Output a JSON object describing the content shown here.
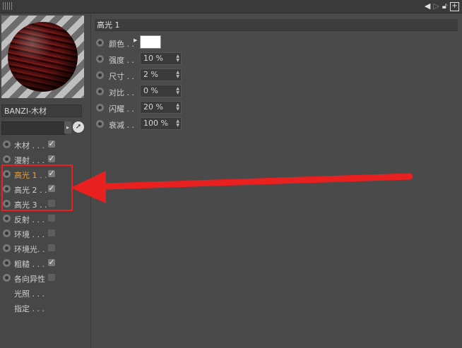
{
  "material_name": "BANZI-木材",
  "channels": [
    {
      "label": "木材 . . .",
      "checked": true
    },
    {
      "label": "漫射 . . .",
      "checked": true
    },
    {
      "label": "高光 1 . .",
      "checked": true,
      "active": true
    },
    {
      "label": "高光 2 . .",
      "checked": true
    },
    {
      "label": "高光 3 . .",
      "checked": false
    },
    {
      "label": "反射 . . .",
      "checked": false
    },
    {
      "label": "环境 . . .",
      "checked": false
    },
    {
      "label": "环境光. .",
      "checked": false
    },
    {
      "label": "粗糙 . . .",
      "checked": true
    },
    {
      "label": "各向异性",
      "checked": false
    },
    {
      "label": "光照 . . .",
      "noradio": true
    },
    {
      "label": "指定 . . .",
      "noradio": true
    }
  ],
  "panel_title": "高光 1",
  "props": [
    {
      "label": "颜色 . .",
      "color": "#ffffff"
    },
    {
      "label": "强度 . .",
      "value": "10 %"
    },
    {
      "label": "尺寸 . .",
      "value": "2 %"
    },
    {
      "label": "对比 . .",
      "value": "0 %"
    },
    {
      "label": "闪耀 . .",
      "value": "20 %"
    },
    {
      "label": "衰减 . .",
      "value": "100 %"
    }
  ],
  "colors": {
    "active_label": "#f0a020",
    "annotation": "#e82020"
  }
}
